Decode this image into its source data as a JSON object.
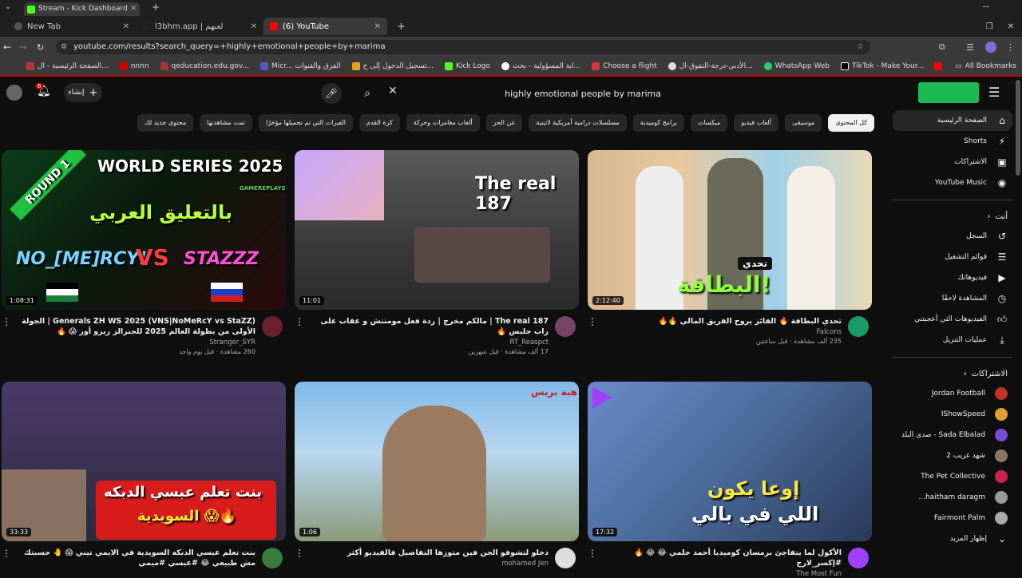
{
  "browser": {
    "tabs": [
      {
        "label": "Stream - Kick Dashboard"
      },
      {
        "label": "New Tab"
      },
      {
        "label": "l3bhm.app | لعبهم"
      },
      {
        "label": "(6) YouTube"
      }
    ],
    "url": "youtube.com/results?search_query=+highly+emotional+people+by+marima",
    "bookmarks": [
      {
        "label": "الصفحة الرئيسية - ال..."
      },
      {
        "label": "nnnn"
      },
      {
        "label": "qeducation.edu.gov..."
      },
      {
        "label": "Micr... الفرق والقنوات"
      },
      {
        "label": "تسجيل الدخول إلى ح..."
      },
      {
        "label": "Kick Logo"
      },
      {
        "label": "ابة المسؤولية - بحث..."
      },
      {
        "label": "Choose a flight"
      },
      {
        "label": "الأدبي-درجة-التفوق-ال..."
      },
      {
        "label": "WhatsApp Web"
      },
      {
        "label": "TikTok - Make Your..."
      },
      {
        "label": "All Bookmarks"
      }
    ]
  },
  "header": {
    "search_query": "highly emotional people by marima",
    "create_label": "إنشاء",
    "notif_count": "6"
  },
  "chips": [
    {
      "label": "كل المحتوى",
      "active": true
    },
    {
      "label": "موسيقى"
    },
    {
      "label": "ألعاب فيديو"
    },
    {
      "label": "ميكسات"
    },
    {
      "label": "برامج كوميدية"
    },
    {
      "label": "مسلسلات درامية أمريكية لاتينية"
    },
    {
      "label": "عن الحر"
    },
    {
      "label": "ألعاب مغامرات وحركة"
    },
    {
      "label": "كرة القدم"
    },
    {
      "label": "الفيرات التي تم تحميلها مؤخرًا"
    },
    {
      "label": "تمت مشاهدتها"
    },
    {
      "label": "محتوى جديد لك"
    }
  ],
  "sidebar": {
    "main": [
      {
        "label": "الصفحة الرئيسية",
        "icon": "home-icon"
      },
      {
        "label": "Shorts",
        "icon": "shorts-icon"
      },
      {
        "label": "الاشتراكات",
        "icon": "subscriptions-icon"
      },
      {
        "label": "YouTube Music",
        "icon": "music-icon"
      }
    ],
    "you_header": "أنت",
    "you": [
      {
        "label": "السجل",
        "icon": "history-icon"
      },
      {
        "label": "قوائم التشغيل",
        "icon": "playlist-icon"
      },
      {
        "label": "فيديوهاتك",
        "icon": "video-icon"
      },
      {
        "label": "المشاهدة لاحقًا",
        "icon": "clock-icon"
      },
      {
        "label": "الفيديوهات التي أعجبتني",
        "icon": "like-icon"
      },
      {
        "label": "عمليات التنزيل",
        "icon": "download-icon"
      }
    ],
    "subs_header": "الاشتراكات",
    "subs": [
      {
        "label": "Jordan Football",
        "color": "#c4302b"
      },
      {
        "label": "IShowSpeed",
        "color": "#e0a030"
      },
      {
        "label": "Sada Elbalad - صدى البلد",
        "color": "#7a4ad8"
      },
      {
        "label": "شهد غريب 2",
        "color": "#887766"
      },
      {
        "label": "The Pet Collective",
        "color": "#d02050"
      },
      {
        "label": "haitham daragm...",
        "color": "#999999"
      },
      {
        "label": "Fairmont Palm",
        "color": "#aaaaaa"
      },
      {
        "label": "إظهار المزيد",
        "color": "#555555"
      }
    ]
  },
  "videos": [
    {
      "title": "Generals ZH WS 2025 (VNS|NoMeRcY vs StaZZ) | الجولة الأولى من بطولة العالم 2025 للجنرالز زيرو أور 😱 🔥",
      "channel": "Stranger_SYR",
      "stats": "260 مشاهدة · قبل يوم واحد",
      "duration": "1:08:31",
      "thumb_text_1": "WORLD SERIES 2025",
      "thumb_text_2": "بالتعليق العربي",
      "thumb_text_3": "NO_[ME]RCY!",
      "thumb_text_4": "VS",
      "thumb_text_5": "STAZZZ",
      "thumb_text_6": "ROUND 1",
      "thumb_text_7": "GAMEREPLAYS"
    },
    {
      "title": "The real 187 | مالكم مخرج | ردة فعل مومنتش و عقاب على راب جلبس 🔥",
      "channel": "RT_Reaspct",
      "stats": "17 ألف مشاهدة · قبل شهرين",
      "duration": "11:01",
      "thumb_text_1": "The real 187"
    },
    {
      "title": "تحدي البطاقة 🔥 الفائز يروح الفريق المالي 🔥🔥",
      "channel": "Falcons",
      "stats": "235 ألف مشاهدة · قبل ساعتين",
      "duration": "2:12:40",
      "thumb_text_1": "تحدي",
      "thumb_text_2": "البطاقة!"
    },
    {
      "title": "بنت تعلم عبسي الدبكه السويدية في الايمي تيني 😱 🤚 حسبتك مش طبيعي 😂 #عبسي #ميمي",
      "channel": "",
      "stats": "",
      "duration": "33:33",
      "thumb_text_1": "بنت تعلم عبسي الدبكه",
      "thumb_text_2": "السويدية 😱🔥"
    },
    {
      "title": "دخلو لتشوفو الجن فين متوزها التفاصيل فالفيديو أكثر",
      "channel": "mohamed Jen",
      "stats": "",
      "duration": "1:06",
      "thumb_text_1": "هبة بريس"
    },
    {
      "title": "الأكول لما يتفاجئ برمسان كوميديا أحمد حلمي 😂 😂 🔥 #إكسر_لارج",
      "channel": "The Most Fun",
      "stats": "",
      "duration": "17:32",
      "thumb_text_1": "إوعا يكون",
      "thumb_text_2": "اللي في بالي"
    }
  ]
}
